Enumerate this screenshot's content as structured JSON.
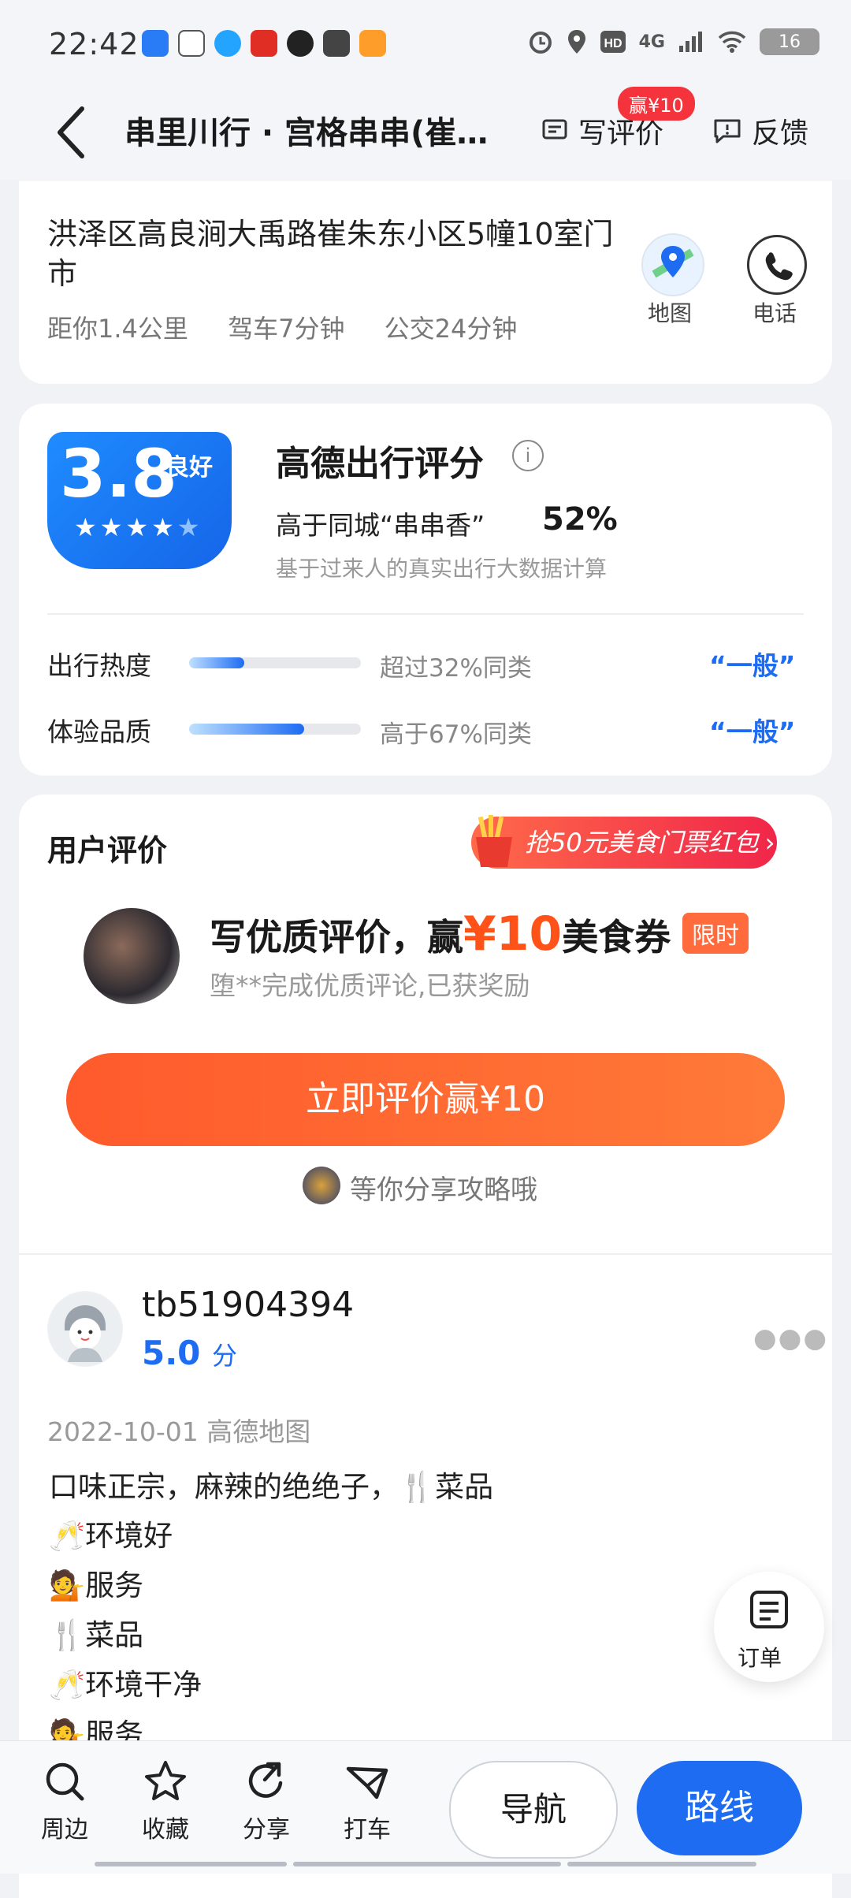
{
  "status_bar": {
    "time": "22:42",
    "network": "4G",
    "battery": "16"
  },
  "header": {
    "title": "串里川行 · 宫格串串(崔…",
    "write_review": "写评价",
    "write_review_badge": "赢¥10",
    "feedback": "反馈"
  },
  "address": {
    "text": "洪泽区高良涧大禹路崔朱东小区5幢10室门市",
    "distance": "距你1.4公里",
    "drive": "驾车7分钟",
    "bus": "公交24分钟",
    "map_label": "地图",
    "phone_label": "电话"
  },
  "rating": {
    "score": "3.8",
    "level": "良好",
    "stars": 4,
    "title": "高德出行评分",
    "compare_text": "高于同城“串串香”",
    "compare_pct": "52%",
    "basis": "基于过来人的真实出行大数据计算",
    "metrics": [
      {
        "label": "出行热度",
        "fill": 0.32,
        "desc": "超过32%同类",
        "level": "“一般”"
      },
      {
        "label": "体验品质",
        "fill": 0.67,
        "desc": "高于67%同类",
        "level": "“一般”"
      }
    ]
  },
  "reviews": {
    "section_title": "用户评价",
    "promo": "抢50元美食门票红包",
    "invite_pre": "写优质评价，赢",
    "invite_amount": "¥10",
    "invite_post": "美食券",
    "limited": "限时",
    "invite_sub": "堕**完成优质评论,已获奖励",
    "cta": "立即评价赢¥10",
    "share": "等你分享攻略哦",
    "items": [
      {
        "user": "tb51904394",
        "score": "5.0",
        "score_unit": "分",
        "date": "2022-10-01 高德地图",
        "lines": [
          "口味正宗，麻辣的绝绝子，🍴菜品",
          "🥂环境好",
          "💁服务",
          "🍴菜品",
          "🥂环境干净",
          "💁服务"
        ]
      }
    ]
  },
  "order_fab": {
    "label": "订单"
  },
  "bottom_bar": {
    "tabs": [
      {
        "label": "周边",
        "icon": "search-icon"
      },
      {
        "label": "收藏",
        "icon": "star-icon"
      },
      {
        "label": "分享",
        "icon": "share-icon"
      },
      {
        "label": "打车",
        "icon": "taxi-icon"
      }
    ],
    "nav": "导航",
    "route": "路线"
  },
  "colors": {
    "accent": "#1d6cf2",
    "promo": "#ff5a2c",
    "badge": "#f4333c"
  }
}
